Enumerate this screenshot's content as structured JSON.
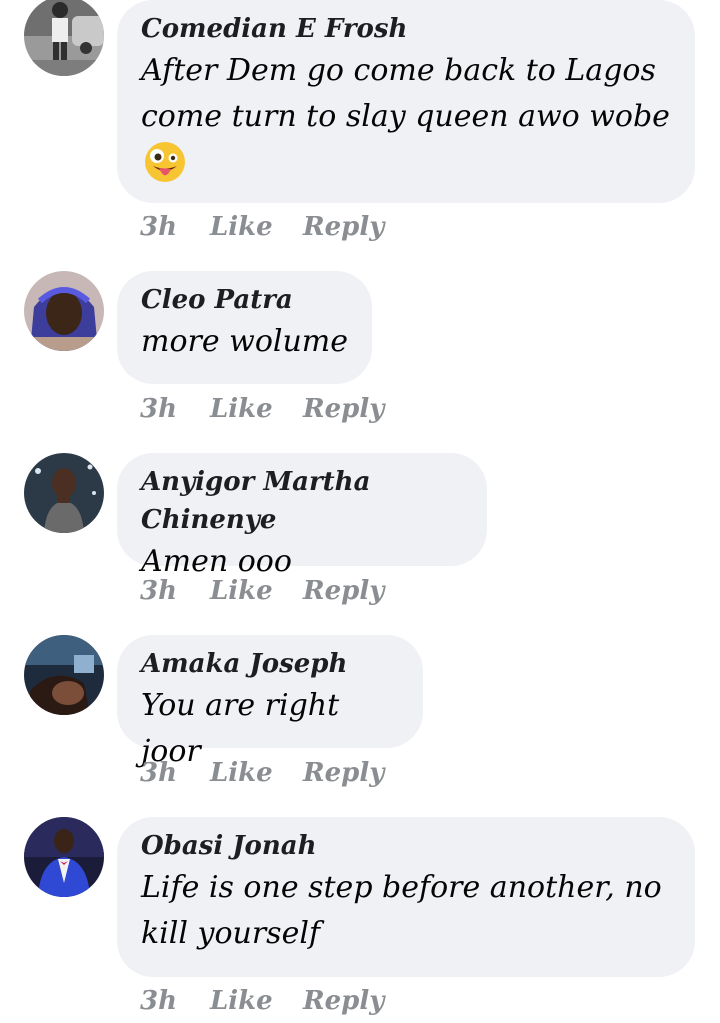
{
  "comments": [
    {
      "author": "Comedian E Frosh",
      "text": "After Dem go come back to Lagos come turn to slay queen awo wobe",
      "time": "3h",
      "like_label": "Like",
      "reply_label": "Reply",
      "emoji": "zany-face-emoji"
    },
    {
      "author": "Cleo Patra",
      "text": "more wolume",
      "time": "3h",
      "like_label": "Like",
      "reply_label": "Reply"
    },
    {
      "author": "Anyigor Martha Chinenye",
      "text": "Amen ooo",
      "time": "3h",
      "like_label": "Like",
      "reply_label": "Reply"
    },
    {
      "author": "Amaka Joseph",
      "text": "You are right joor",
      "time": "3h",
      "like_label": "Like",
      "reply_label": "Reply"
    },
    {
      "author": "Obasi Jonah",
      "text": "Life is one step before another, no kill yourself",
      "time": "3h",
      "like_label": "Like",
      "reply_label": "Reply"
    }
  ],
  "colors": {
    "bubble": "#f0f1f5",
    "name": "#1c1e21",
    "text": "#050505",
    "meta": "#8a8d91"
  }
}
